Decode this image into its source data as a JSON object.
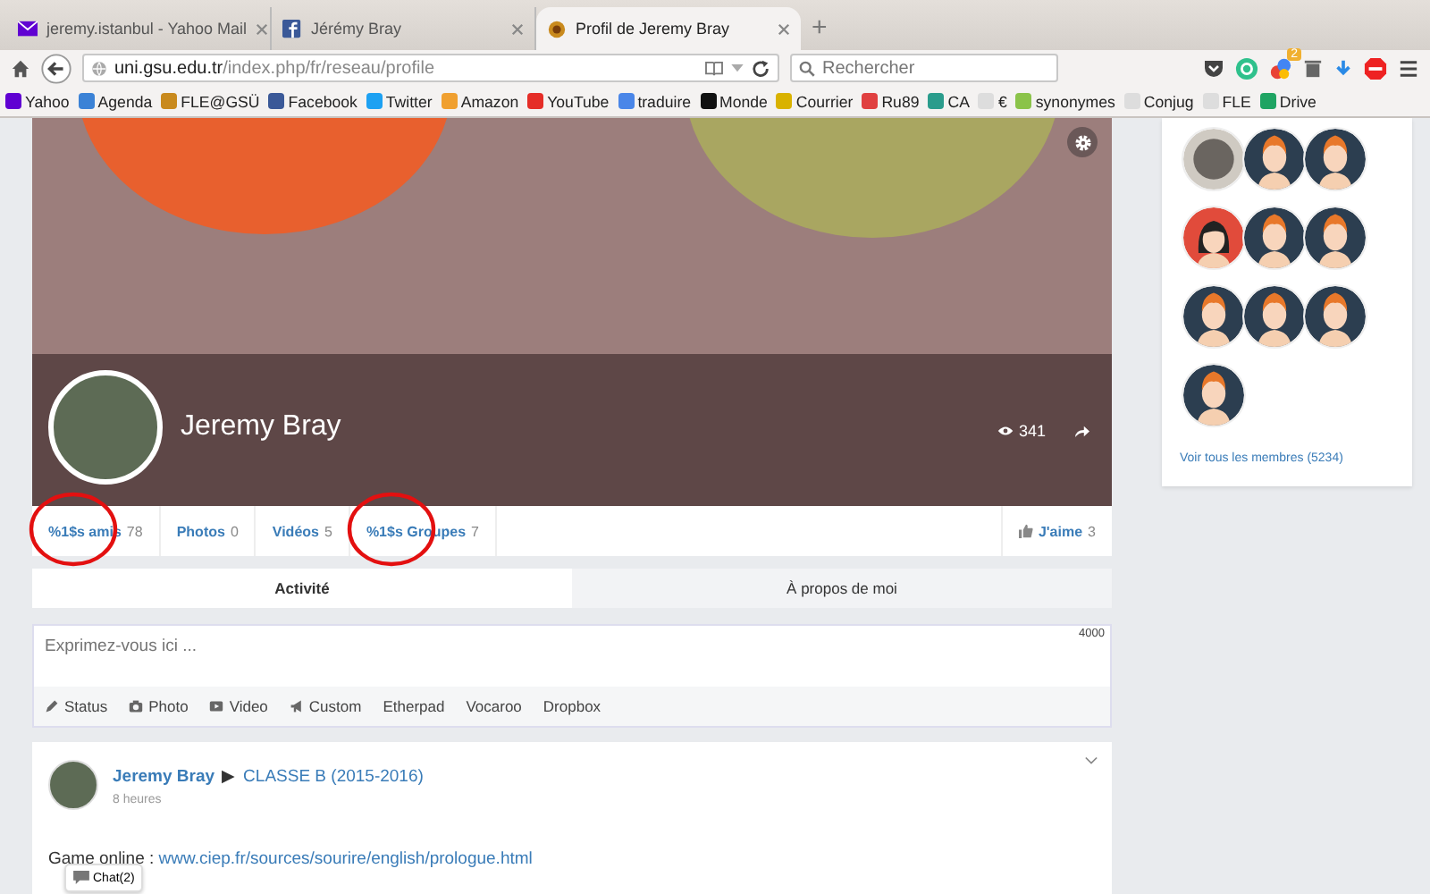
{
  "browser_tabs": [
    {
      "title": "jeremy.istanbul - Yahoo Mail",
      "kind": "mail",
      "selected": false
    },
    {
      "title": "Jérémy Bray",
      "kind": "facebook",
      "selected": false
    },
    {
      "title": "Profil de Jeremy Bray",
      "kind": "site",
      "selected": true
    }
  ],
  "new_tab": "+",
  "address_bar": {
    "host": "uni.gsu.edu.tr",
    "path": "/index.php/fr/reseau/profile"
  },
  "search": {
    "placeholder": "Rechercher"
  },
  "toolbar_badge": "2",
  "bookmarks": [
    {
      "label": "Yahoo",
      "color": "#6001d2"
    },
    {
      "label": "Agenda",
      "color": "#3b82d6"
    },
    {
      "label": "FLE@GSÜ",
      "color": "#c98a1d"
    },
    {
      "label": "Facebook",
      "color": "#3b5998"
    },
    {
      "label": "Twitter",
      "color": "#1da1f2"
    },
    {
      "label": "Amazon",
      "color": "#f0a030"
    },
    {
      "label": "YouTube",
      "color": "#e52d27"
    },
    {
      "label": "traduire",
      "color": "#4a86e8"
    },
    {
      "label": "Monde",
      "color": "#111111"
    },
    {
      "label": "Courrier",
      "color": "#d9b200"
    },
    {
      "label": "Ru89",
      "color": "#e04040"
    },
    {
      "label": "CA",
      "color": "#2a9c8c"
    },
    {
      "label": "€",
      "color": "#dddddd"
    },
    {
      "label": "synonymes",
      "color": "#8bc34a"
    },
    {
      "label": "Conjug",
      "color": "#dddddd"
    },
    {
      "label": "FLE",
      "color": "#dddddd"
    },
    {
      "label": "Drive",
      "color": "#1fa463"
    }
  ],
  "profile": {
    "name": "Jeremy Bray",
    "views": "341",
    "stats": [
      {
        "label": "%1$s amis",
        "count": "78",
        "circled": true
      },
      {
        "label": "Photos",
        "count": "0",
        "circled": false
      },
      {
        "label": "Vidéos",
        "count": "5",
        "circled": false
      },
      {
        "label": "%1$s Groupes",
        "count": "7",
        "circled": true
      }
    ],
    "likes": {
      "label": "J'aime",
      "count": "3"
    },
    "tabs": [
      {
        "label": "Activité",
        "selected": true
      },
      {
        "label": "À propos de moi",
        "selected": false
      }
    ]
  },
  "composer": {
    "placeholder": "Exprimez-vous ici ...",
    "counter": "4000",
    "actions": [
      {
        "label": "Status",
        "kind": "pencil"
      },
      {
        "label": "Photo",
        "kind": "camera"
      },
      {
        "label": "Video",
        "kind": "video"
      },
      {
        "label": "Custom",
        "kind": "megaphone"
      },
      {
        "label": "Etherpad",
        "kind": "none"
      },
      {
        "label": "Vocaroo",
        "kind": "none"
      },
      {
        "label": "Dropbox",
        "kind": "none"
      }
    ]
  },
  "post": {
    "author": "Jeremy Bray",
    "separator": "▶",
    "target": "CLASSE B (2015-2016)",
    "time": "8 heures",
    "text": "Game online : ",
    "link": "www.ciep.fr/sources/sourire/english/prologue.html"
  },
  "members": {
    "avatars": [
      {
        "kind": "photo"
      },
      {
        "kind": "male"
      },
      {
        "kind": "male"
      },
      {
        "kind": "female"
      },
      {
        "kind": "male"
      },
      {
        "kind": "male"
      },
      {
        "kind": "male"
      },
      {
        "kind": "male"
      },
      {
        "kind": "male"
      },
      {
        "kind": "male"
      }
    ],
    "link": "Voir tous les membres (5234)"
  },
  "chat": {
    "label": "Chat(2)"
  }
}
